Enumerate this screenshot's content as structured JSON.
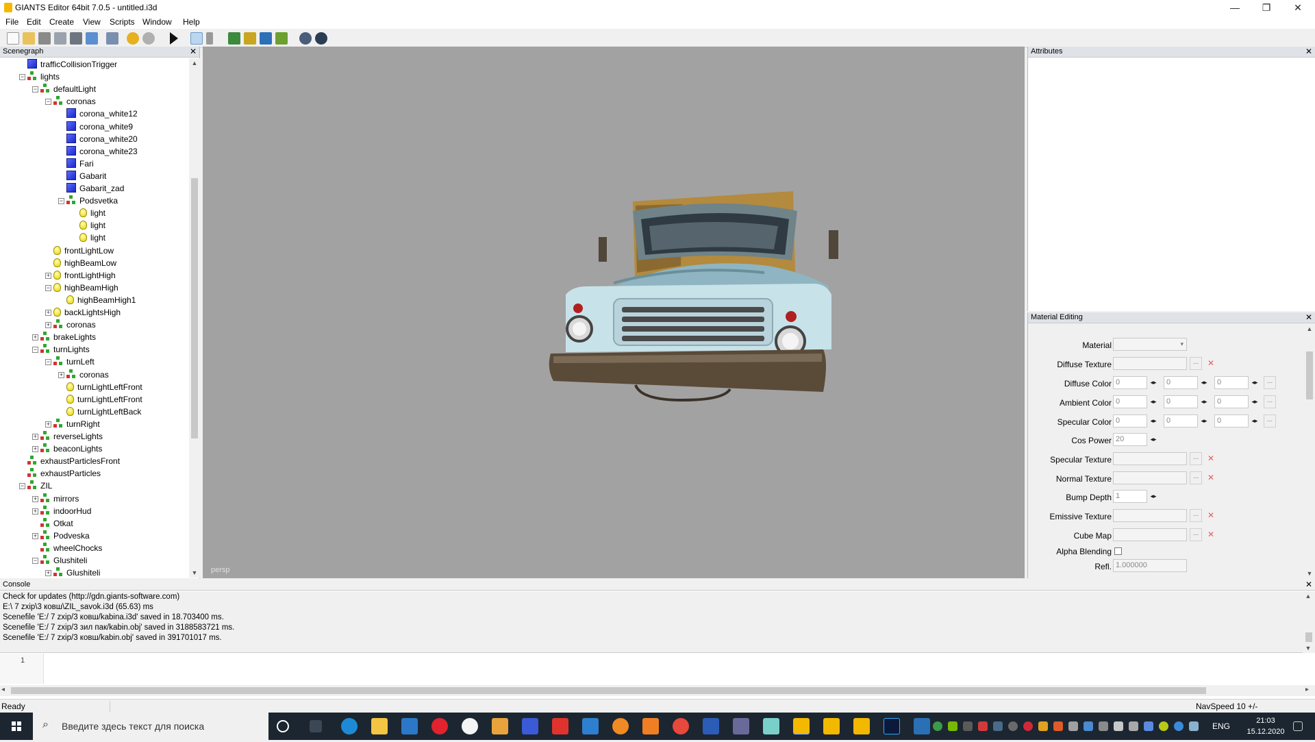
{
  "window": {
    "title": "GIANTS Editor 64bit 7.0.5 - untitled.i3d",
    "minimize": "—",
    "maximize": "❐",
    "close": "✕"
  },
  "menu": [
    "File",
    "Edit",
    "Create",
    "View",
    "Scripts",
    "Window",
    "Help"
  ],
  "panels": {
    "scenegraph": "Scenegraph",
    "attributes": "Attributes",
    "material": "Material Editing",
    "console": "Console"
  },
  "scenegraph": {
    "rows": [
      {
        "label": "trafficCollisionTrigger",
        "type": "shape",
        "exp": ""
      },
      {
        "label": "lights",
        "type": "group",
        "exp": "−"
      },
      {
        "label": "defaultLight",
        "type": "group",
        "exp": "−"
      },
      {
        "label": "coronas",
        "type": "group",
        "exp": "−"
      },
      {
        "label": "corona_white12",
        "type": "shape",
        "exp": ""
      },
      {
        "label": "corona_white9",
        "type": "shape",
        "exp": ""
      },
      {
        "label": "corona_white20",
        "type": "shape",
        "exp": ""
      },
      {
        "label": "corona_white23",
        "type": "shape",
        "exp": ""
      },
      {
        "label": "Fari",
        "type": "shape",
        "exp": ""
      },
      {
        "label": "Gabarit",
        "type": "shape",
        "exp": ""
      },
      {
        "label": "Gabarit_zad",
        "type": "shape",
        "exp": ""
      },
      {
        "label": "Podsvetka",
        "type": "group",
        "exp": "−"
      },
      {
        "label": "light",
        "type": "light",
        "exp": ""
      },
      {
        "label": "light",
        "type": "light",
        "exp": ""
      },
      {
        "label": "light",
        "type": "light",
        "exp": ""
      },
      {
        "label": "frontLightLow",
        "type": "light",
        "exp": ""
      },
      {
        "label": "highBeamLow",
        "type": "light",
        "exp": ""
      },
      {
        "label": "frontLightHigh",
        "type": "light",
        "exp": "+"
      },
      {
        "label": "highBeamHigh",
        "type": "light",
        "exp": "−"
      },
      {
        "label": "highBeamHigh1",
        "type": "light",
        "exp": ""
      },
      {
        "label": "backLightsHigh",
        "type": "light",
        "exp": "+"
      },
      {
        "label": "coronas",
        "type": "group",
        "exp": "+"
      },
      {
        "label": "brakeLights",
        "type": "group",
        "exp": "+"
      },
      {
        "label": "turnLights",
        "type": "group",
        "exp": "−"
      },
      {
        "label": "turnLeft",
        "type": "group",
        "exp": "−"
      },
      {
        "label": "coronas",
        "type": "group",
        "exp": "+"
      },
      {
        "label": "turnLightLeftFront",
        "type": "light",
        "exp": ""
      },
      {
        "label": "turnLightLeftFront",
        "type": "light",
        "exp": ""
      },
      {
        "label": "turnLightLeftBack",
        "type": "light",
        "exp": ""
      },
      {
        "label": "turnRight",
        "type": "group",
        "exp": "+"
      },
      {
        "label": "reverseLights",
        "type": "group",
        "exp": "+"
      },
      {
        "label": "beaconLights",
        "type": "group",
        "exp": "+"
      },
      {
        "label": "exhaustParticlesFront",
        "type": "group",
        "exp": ""
      },
      {
        "label": "exhaustParticles",
        "type": "group",
        "exp": ""
      },
      {
        "label": "ZIL",
        "type": "group",
        "exp": "−"
      },
      {
        "label": "mirrors",
        "type": "group",
        "exp": "+"
      },
      {
        "label": "indoorHud",
        "type": "group",
        "exp": "+"
      },
      {
        "label": "Otkat",
        "type": "group",
        "exp": ""
      },
      {
        "label": "Podveska",
        "type": "group",
        "exp": "+"
      },
      {
        "label": "wheelChocks",
        "type": "group",
        "exp": ""
      },
      {
        "label": "Glushiteli",
        "type": "group",
        "exp": "−"
      },
      {
        "label": "Glushiteli",
        "type": "group",
        "exp": "+"
      }
    ]
  },
  "viewport": {
    "camera": "persp"
  },
  "material": {
    "material_label": "Material",
    "diffuse_texture_label": "Diffuse Texture",
    "diffuse_color_label": "Diffuse Color",
    "diffuse_color": [
      "0",
      "0",
      "0"
    ],
    "ambient_color_label": "Ambient Color",
    "ambient_color": [
      "0",
      "0",
      "0"
    ],
    "specular_color_label": "Specular Color",
    "specular_color": [
      "0",
      "0",
      "0"
    ],
    "cos_power_label": "Cos Power",
    "cos_power": "20",
    "specular_texture_label": "Specular Texture",
    "normal_texture_label": "Normal Texture",
    "bump_depth_label": "Bump Depth",
    "bump_depth": "1",
    "emissive_texture_label": "Emissive Texture",
    "cube_map_label": "Cube Map",
    "alpha_blending_label": "Alpha Blending",
    "refl_label": "Refl.",
    "refl": "1.000000",
    "dots": "...",
    "x": "✕"
  },
  "console": {
    "lines": [
      "Check for updates (http://gdn.giants-software.com)",
      "E:\\ 7 zxip\\3 ковш\\ZIL_savok.i3d (65.63) ms",
      "Scenefile 'E:/ 7 zxip/3 ковш/kabina.i3d' saved in 18.703400 ms.",
      "Scenefile 'E:/ 7 zxip/3 зил пак/kabin.obj' saved in 3188583721 ms.",
      "Scenefile 'E:/ 7 zxip/3 ковш/kabin.obj' saved in 391701017 ms."
    ],
    "line_number": "1"
  },
  "status": {
    "left": "Ready",
    "right": "NavSpeed 10 +/-"
  },
  "taskbar": {
    "search_placeholder": "Введите здесь текст для поиска",
    "lang": "ENG",
    "time": "21:03",
    "date": "15.12.2020"
  },
  "colors": {
    "viewport_bg": "#a2a2a2",
    "taskbar_bg": "#1c2630",
    "panel_header": "#dfe3e8"
  }
}
